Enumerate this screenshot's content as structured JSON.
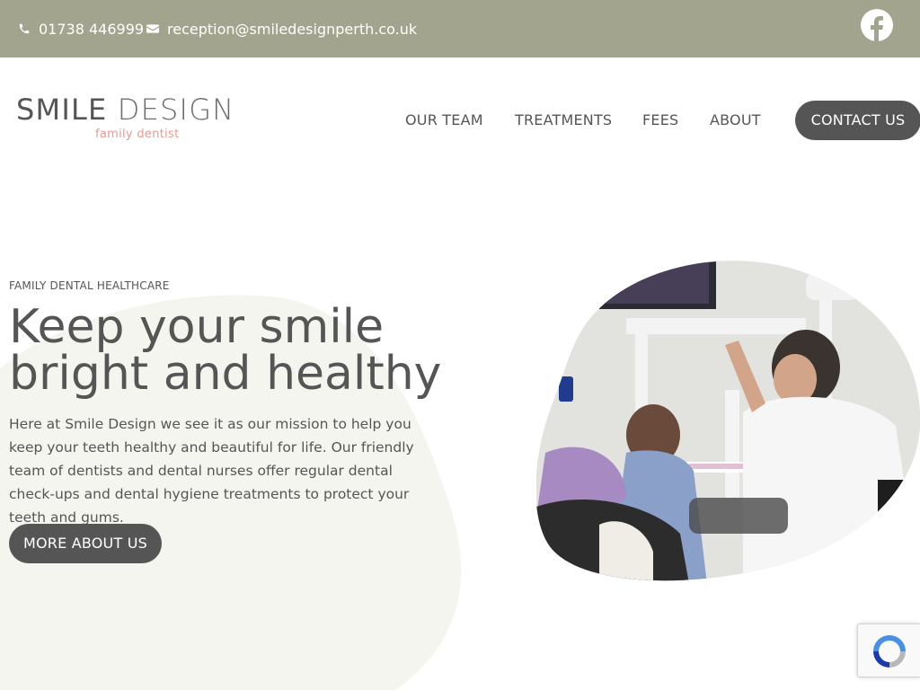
{
  "topbar": {
    "phone": "01738 446999",
    "email": "reception@smiledesignperth.co.uk",
    "phone_icon": "phone-icon",
    "email_icon": "envelope-icon",
    "social_icon": "facebook-icon",
    "background_color": "#a2a48d"
  },
  "header": {
    "logo": {
      "word_smile": "SMILE",
      "word_design": "DESIGN",
      "tagline": "family dentist"
    },
    "nav": [
      {
        "label": "OUR TEAM"
      },
      {
        "label": "TREATMENTS"
      },
      {
        "label": "FEES"
      },
      {
        "label": "ABOUT"
      }
    ],
    "contact_button": "CONTACT US"
  },
  "hero": {
    "eyebrow": "FAMILY DENTAL HEALTHCARE",
    "headline": "Keep your smile bright and healthy",
    "body": "Here at Smile Design we see it as our mission to help you keep your teeth healthy and beautiful for life. Our friendly team of dentists and dental nurses offer regular dental check-ups and dental hygiene treatments to protect your teeth and gums.",
    "cta": "MORE ABOUT US"
  },
  "widgets": {
    "recaptcha_icon": "recaptcha-icon"
  },
  "colors": {
    "accent_dark": "#555555",
    "logo_pink": "#e59a93",
    "blob_background": "#f5f5f0"
  }
}
